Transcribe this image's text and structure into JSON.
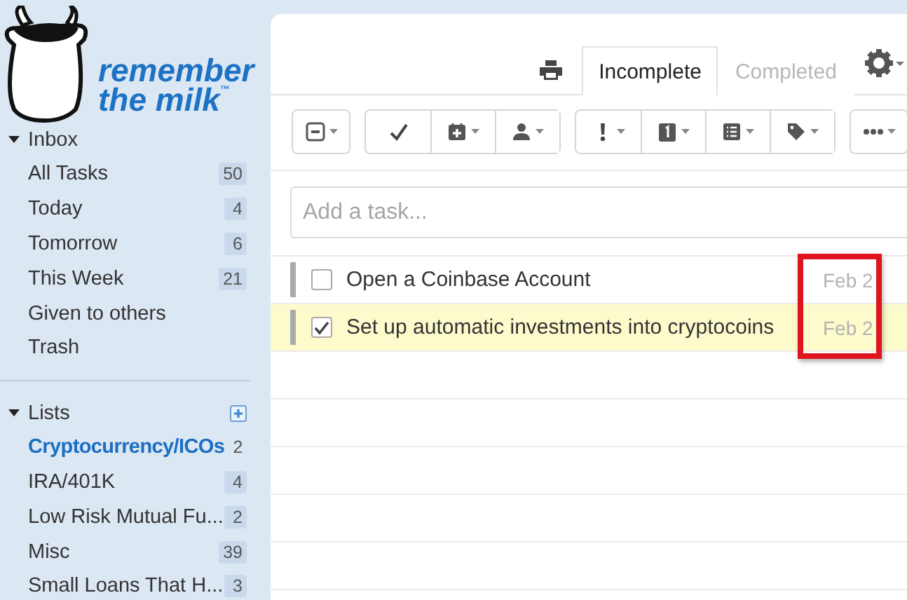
{
  "logo": {
    "line_1": "remember",
    "line_2": "the milk",
    "mark": "™"
  },
  "sidebar": {
    "sections": [
      {
        "title": "Inbox",
        "expanded": true,
        "add_button": false,
        "items": [
          {
            "label": "All Tasks",
            "count": "50",
            "selected": false
          },
          {
            "label": "Today",
            "count": "4",
            "selected": false
          },
          {
            "label": "Tomorrow",
            "count": "6",
            "selected": false
          },
          {
            "label": "This Week",
            "count": "21",
            "selected": false
          },
          {
            "label": "Given to others",
            "selected": false
          },
          {
            "label": "Trash",
            "selected": false
          }
        ]
      },
      {
        "title": "Lists",
        "expanded": true,
        "add_button": true,
        "items": [
          {
            "label": "Cryptocurrency/ICOs",
            "count": "2",
            "selected": true
          },
          {
            "label": "IRA/401K",
            "count": "4",
            "selected": false
          },
          {
            "label": "Low Risk Mutual Fu...",
            "count": "2",
            "selected": false
          },
          {
            "label": "Misc",
            "count": "39",
            "selected": false
          },
          {
            "label": "Small Loans That H...",
            "count": "3",
            "selected": false
          }
        ]
      }
    ]
  },
  "tabs": [
    {
      "label": "Incomplete",
      "selected": true
    },
    {
      "label": "Completed",
      "selected": false
    }
  ],
  "toolbar": [
    [
      {
        "kind": "select",
        "dropdown": true
      }
    ],
    [
      {
        "kind": "complete",
        "dropdown": false
      },
      {
        "kind": "postpone",
        "dropdown": true
      },
      {
        "kind": "assign",
        "dropdown": true
      }
    ],
    [
      {
        "kind": "priority",
        "dropdown": true
      },
      {
        "kind": "due",
        "dropdown": true
      },
      {
        "kind": "list",
        "dropdown": true
      },
      {
        "kind": "tag",
        "dropdown": true
      }
    ],
    [
      {
        "kind": "more",
        "dropdown": true
      }
    ]
  ],
  "add_task": {
    "placeholder": "Add a task..."
  },
  "tasks": [
    {
      "title": "Open a Coinbase Account",
      "due": "Feb 2",
      "checked": false,
      "selected": false
    },
    {
      "title": "Set up automatic investments into cryptocoins",
      "due": "Feb 2",
      "checked": true,
      "selected": true
    }
  ],
  "annotation": {
    "kind": "box"
  }
}
